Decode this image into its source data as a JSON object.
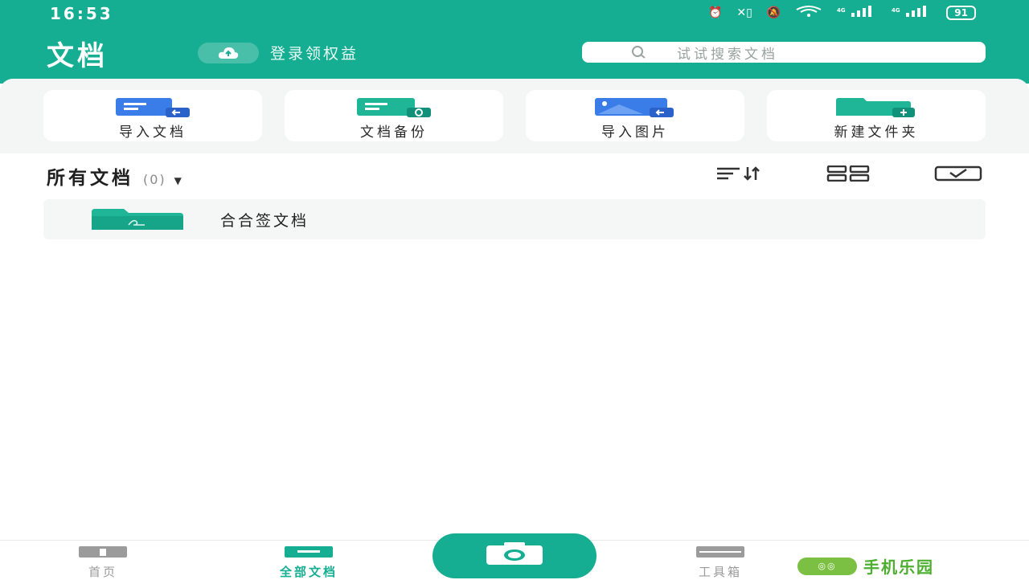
{
  "status_bar": {
    "time": "16:53",
    "battery": "91",
    "icons": [
      "alarm-icon",
      "no-sim-icon",
      "mute-icon",
      "wifi-icon",
      "signal-4g-icon",
      "signal-4g-icon",
      "battery-icon"
    ]
  },
  "header": {
    "title": "文档",
    "login_text": "登录领权益",
    "search_placeholder": "试试搜索文档",
    "accent_color": "#16ae92"
  },
  "quick_actions": [
    {
      "label": "导入文档",
      "icon": "import-document-icon"
    },
    {
      "label": "文档备份",
      "icon": "backup-document-icon"
    },
    {
      "label": "导入图片",
      "icon": "import-image-icon"
    },
    {
      "label": "新建文件夹",
      "icon": "new-folder-icon"
    }
  ],
  "section": {
    "title": "所有文档",
    "count": "(0)"
  },
  "toolbar": {
    "icons": [
      "sort-icon",
      "grid-view-icon",
      "select-icon"
    ]
  },
  "files": [
    {
      "name": "合合签文档",
      "icon": "signature-folder-icon"
    }
  ],
  "bottom_nav": {
    "items": [
      {
        "label": "首页",
        "icon": "home-icon",
        "active": false
      },
      {
        "label": "全部文档",
        "icon": "documents-icon",
        "active": true
      },
      {
        "label": "工具箱",
        "icon": "toolbox-icon",
        "active": false
      }
    ],
    "camera_icon": "camera-icon"
  },
  "watermark": {
    "text": "手机乐园"
  }
}
